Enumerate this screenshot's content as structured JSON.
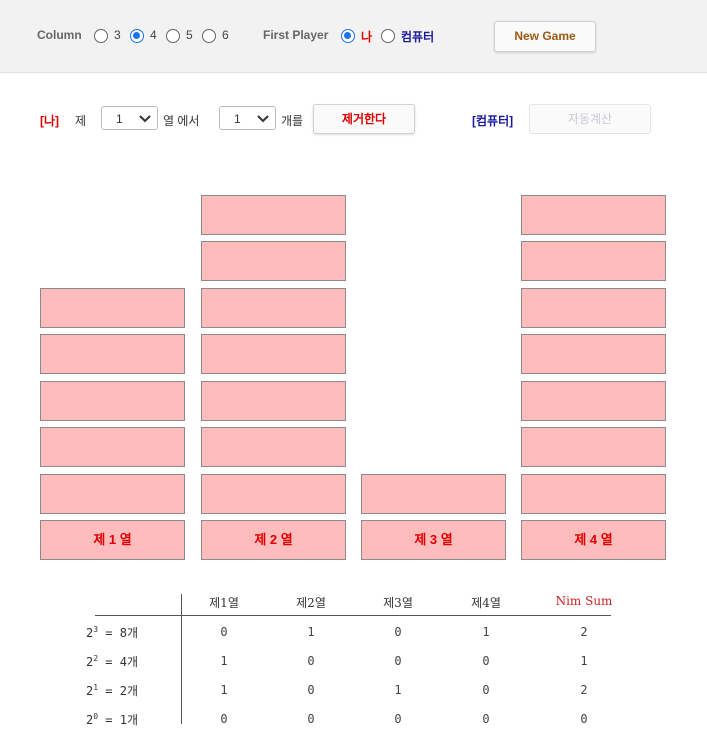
{
  "topbar": {
    "column_label": "Column",
    "column_options": [
      "3",
      "4",
      "5",
      "6"
    ],
    "column_selected": "4",
    "first_player_label": "First Player",
    "first_player_options": [
      "나",
      "컴퓨터"
    ],
    "first_player_selected": "나",
    "new_game_label": "New Game"
  },
  "controls": {
    "player_tag": "[나]",
    "prefix": "제",
    "column_value": "1",
    "column_suffix": "열 에서",
    "count_value": "1",
    "count_suffix": "개를",
    "remove_label": "제거한다",
    "computer_tag": "[컴퓨터]",
    "auto_label": "자동계산"
  },
  "board": {
    "columns": [
      {
        "label": "제 1 열",
        "count": 5
      },
      {
        "label": "제 2 열",
        "count": 7
      },
      {
        "label": "제 3 열",
        "count": 1
      },
      {
        "label": "제 4 열",
        "count": 7
      }
    ]
  },
  "nim_table": {
    "headers": [
      "제1열",
      "제2열",
      "제3열",
      "제4열",
      "Nim Sum"
    ],
    "rows": [
      {
        "base": "2",
        "exp": "3",
        "rest": " = 8개",
        "bits": [
          "0",
          "1",
          "0",
          "1",
          "2"
        ]
      },
      {
        "base": "2",
        "exp": "2",
        "rest": " = 4개",
        "bits": [
          "1",
          "0",
          "0",
          "0",
          "1"
        ]
      },
      {
        "base": "2",
        "exp": "1",
        "rest": " = 2개",
        "bits": [
          "1",
          "0",
          "1",
          "0",
          "2"
        ]
      },
      {
        "base": "2",
        "exp": "0",
        "rest": " = 1개",
        "bits": [
          "0",
          "0",
          "0",
          "0",
          "0"
        ]
      }
    ]
  },
  "colors": {
    "accent": "#1a73e8",
    "block_fill": "#ffbcbc",
    "red_text": "#e00000",
    "blue_text": "#1a1aa0",
    "new_game_text": "#9a5a14",
    "nim_sum_header": "#cc2222"
  }
}
